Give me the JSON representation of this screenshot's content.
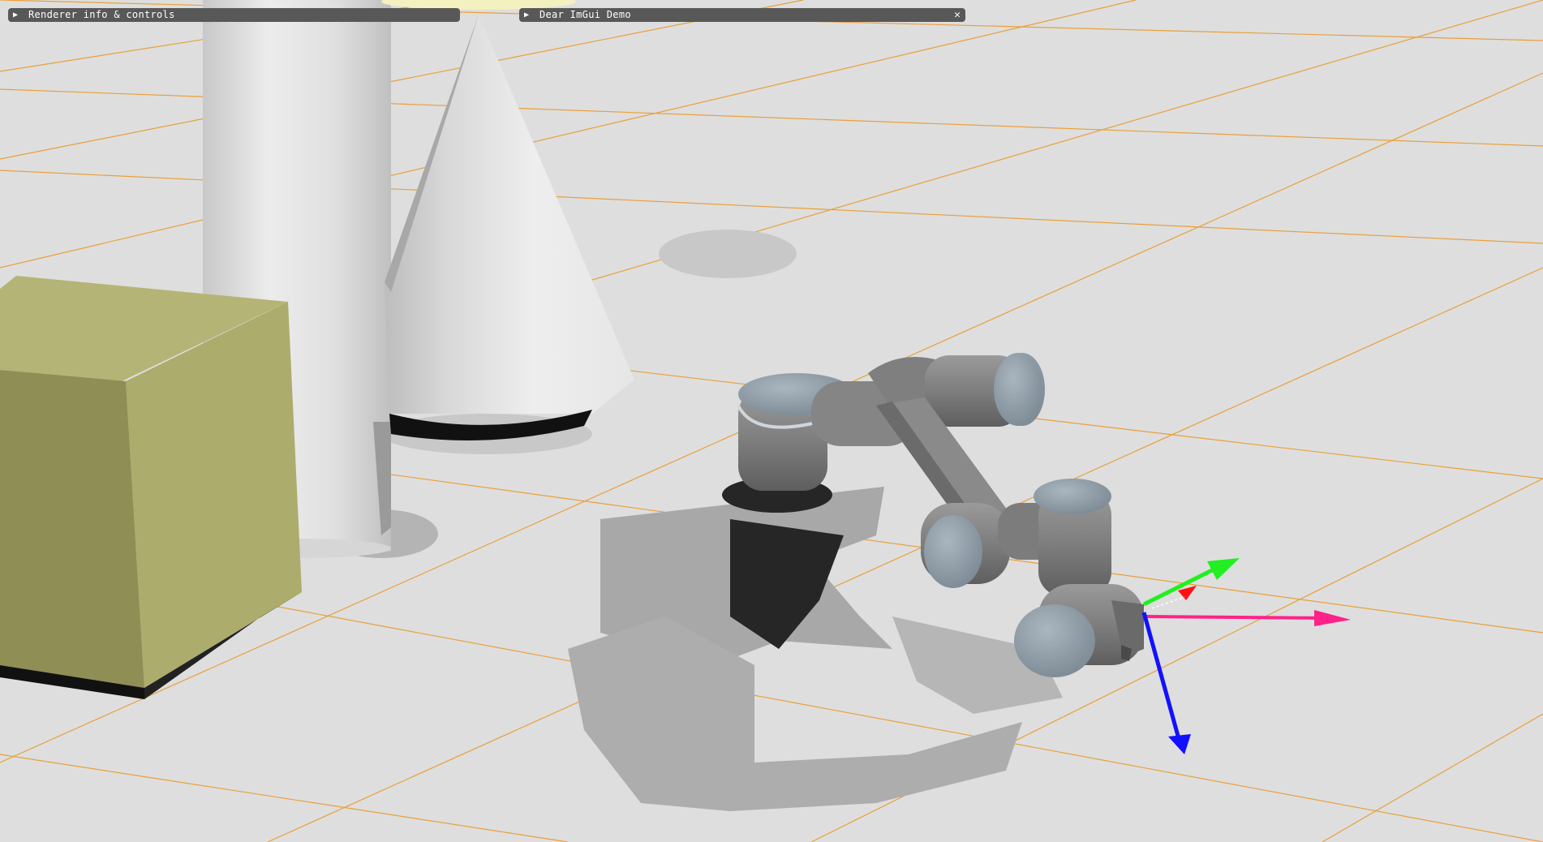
{
  "windows": {
    "renderer": {
      "title": "Renderer info & controls",
      "collapse_icon": "triangle-right-icon"
    },
    "demo": {
      "title": "Dear ImGui Demo",
      "collapse_icon": "triangle-right-icon",
      "close_icon": "close-icon",
      "close_glyph": "✕"
    }
  },
  "scene": {
    "background_color": "#dddddd",
    "grid_color": "#e89a2a",
    "box_color": "#acac6c",
    "robot_color": "#808080",
    "robot_cap_color": "#8f9ea9",
    "axis_colors": {
      "x": "#ff2288",
      "y": "#22ee22",
      "z": "#1111ff",
      "marker": "#ff1111"
    }
  }
}
